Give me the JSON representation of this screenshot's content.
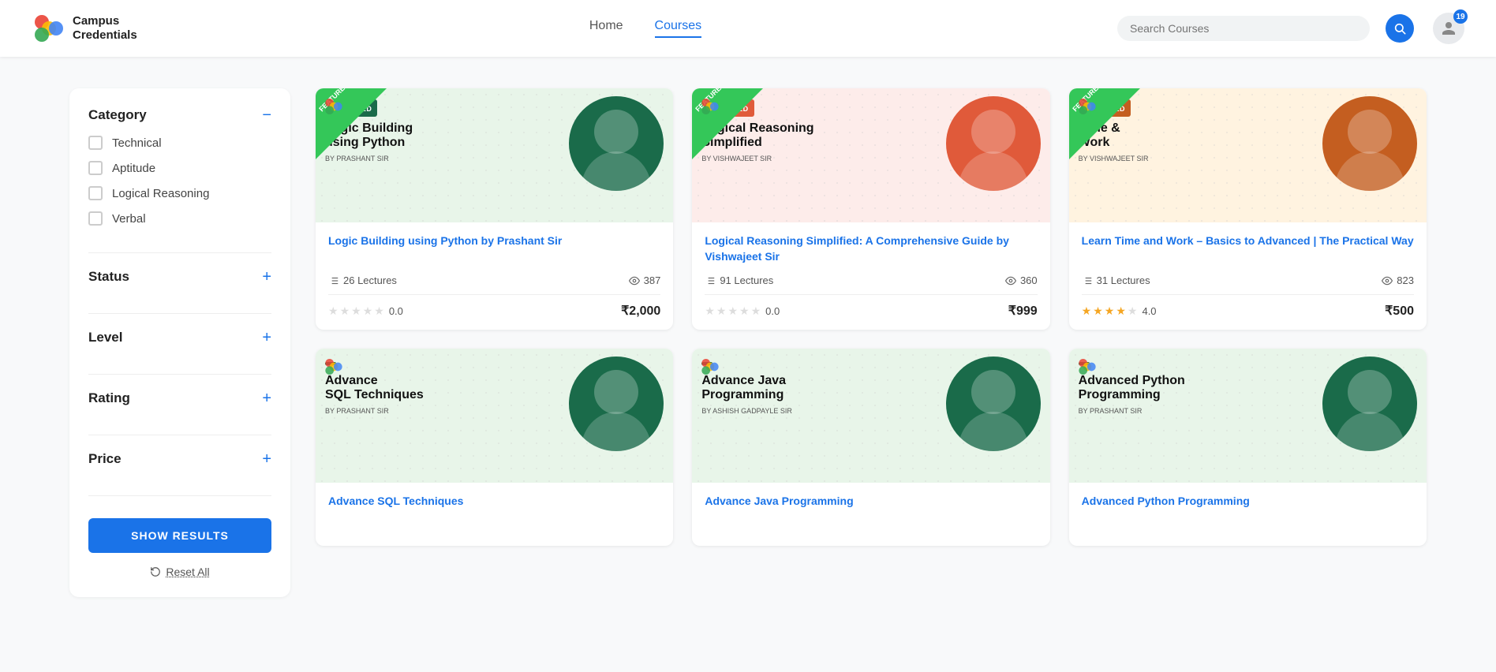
{
  "header": {
    "logo_text_line1": "Campus",
    "logo_text_line2": "Credentials",
    "nav": [
      {
        "label": "Home",
        "active": false
      },
      {
        "label": "Courses",
        "active": true
      }
    ],
    "search_placeholder": "Search Courses",
    "notification_count": "19"
  },
  "sidebar": {
    "category_title": "Category",
    "categories": [
      {
        "label": "Technical"
      },
      {
        "label": "Aptitude"
      },
      {
        "label": "Logical Reasoning"
      },
      {
        "label": "Verbal"
      }
    ],
    "status_title": "Status",
    "level_title": "Level",
    "rating_title": "Rating",
    "price_title": "Price",
    "show_results_label": "SHOW RESULTS",
    "reset_label": "Reset All"
  },
  "courses": [
    {
      "id": 1,
      "title": "Logic Building using Python by Prashant Sir",
      "featured": true,
      "thumb_course_name": "Logic Building\nusing Python",
      "thumb_author": "BY PRASHANT SIR",
      "thumb_badge": "FEATURED",
      "thumb_bg_color": "#1a6b4a",
      "thumb_circle_color": "#1a6b4a",
      "lectures": "26 Lectures",
      "views": "387",
      "rating": 0.0,
      "rating_display": "0.0",
      "price": "₹2,000",
      "stars": [
        0,
        0,
        0,
        0,
        0
      ]
    },
    {
      "id": 2,
      "title": "Logical Reasoning Simplified: A Comprehensive Guide by Vishwajeet Sir",
      "featured": true,
      "thumb_course_name": "Logical Reasoning\nSimplified",
      "thumb_author": "BY VISHWAJEET SIR",
      "thumb_badge": "FEATURED",
      "thumb_bg_color": "#e05a3a",
      "thumb_circle_color": "#e05a3a",
      "lectures": "91 Lectures",
      "views": "360",
      "rating": 0.0,
      "rating_display": "0.0",
      "price": "₹999",
      "stars": [
        0,
        0,
        0,
        0,
        0
      ]
    },
    {
      "id": 3,
      "title": "Learn Time and Work – Basics to Advanced | The Practical Way",
      "featured": true,
      "thumb_course_name": "Time &\nWork",
      "thumb_author": "BY VISHWAJEET SIR",
      "thumb_badge": "FEATURED",
      "thumb_bg_color": "#c45e20",
      "thumb_circle_color": "#c45e20",
      "lectures": "31 Lectures",
      "views": "823",
      "rating": 4.0,
      "rating_display": "4.0",
      "price": "₹500",
      "stars": [
        1,
        1,
        1,
        1,
        0
      ]
    },
    {
      "id": 4,
      "title": "Advance SQL Techniques",
      "featured": false,
      "thumb_course_name": "Advance\nSQL Techniques",
      "thumb_author": "BY PRASHANT SIR",
      "thumb_badge": "",
      "thumb_bg_color": "#1a6b4a",
      "thumb_circle_color": "#1a6b4a",
      "lectures": "",
      "views": "",
      "rating": 0,
      "rating_display": "",
      "price": "",
      "stars": []
    },
    {
      "id": 5,
      "title": "Advance Java Programming",
      "featured": false,
      "thumb_course_name": "Advance Java\nProgramming",
      "thumb_author": "BY ASHISH GADPAYLE SIR",
      "thumb_badge": "",
      "thumb_bg_color": "#1a6b4a",
      "thumb_circle_color": "#1a6b4a",
      "lectures": "",
      "views": "",
      "rating": 0,
      "rating_display": "",
      "price": "",
      "stars": []
    },
    {
      "id": 6,
      "title": "Advanced Python Programming",
      "featured": false,
      "thumb_course_name": "Advanced Python\nProgramming",
      "thumb_author": "BY PRASHANT SIR",
      "thumb_badge": "",
      "thumb_bg_color": "#1a6b4a",
      "thumb_circle_color": "#1a6b4a",
      "lectures": "",
      "views": "",
      "rating": 0,
      "rating_display": "",
      "price": "",
      "stars": []
    }
  ]
}
